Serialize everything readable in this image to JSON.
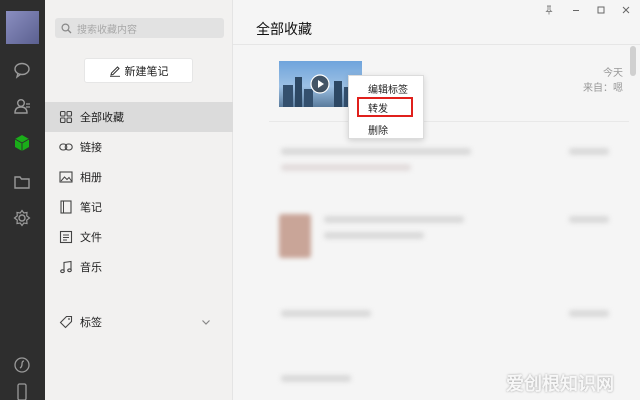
{
  "nav": {
    "search_placeholder": "搜索收藏内容",
    "new_note_label": "新建笔记",
    "items": [
      {
        "label": "全部收藏",
        "icon": "grid-icon",
        "active": true
      },
      {
        "label": "链接",
        "icon": "link-icon"
      },
      {
        "label": "相册",
        "icon": "image-icon"
      },
      {
        "label": "笔记",
        "icon": "note-icon"
      },
      {
        "label": "文件",
        "icon": "file-icon"
      },
      {
        "label": "音乐",
        "icon": "music-icon"
      }
    ],
    "tags_label": "标签"
  },
  "main": {
    "title": "全部收藏",
    "first_item": {
      "time": "今天",
      "source": "来自：嗯",
      "type": "video"
    }
  },
  "context_menu": {
    "items": [
      "编辑标签",
      "转发",
      "删除"
    ],
    "highlighted": "转发",
    "highlight_color": "#e0201c"
  },
  "colors": {
    "rail_bg": "#2e2e2e",
    "rail_active": "#1aad19",
    "nav_bg": "#f2f1f0",
    "nav_active": "#dbdbdb"
  },
  "watermark": "爱创根知识网"
}
